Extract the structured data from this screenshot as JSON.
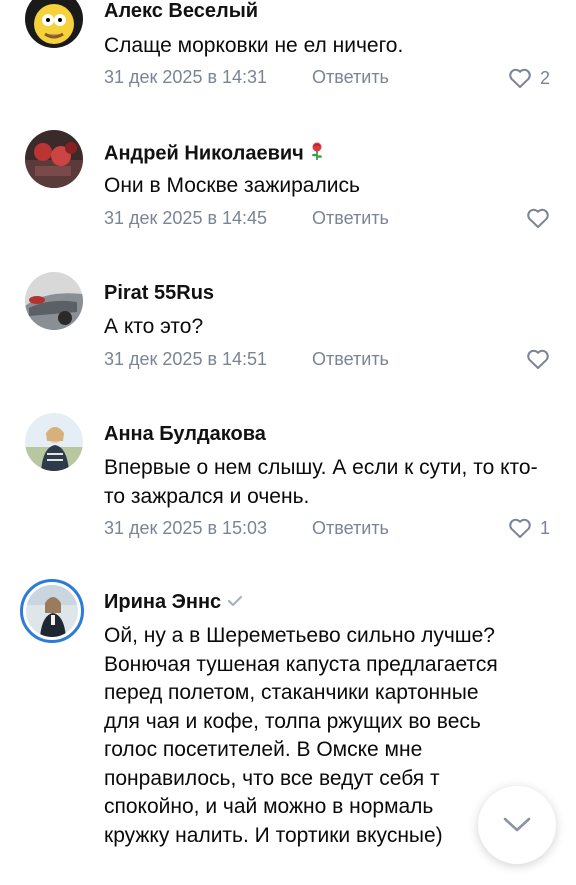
{
  "comments": [
    {
      "author": "Алекс Веселый",
      "text": "Слаще морковки не ел ничего.",
      "date": "31 дек 2025 в 14:31",
      "reply_label": "Ответить",
      "likes": "2",
      "avatar_icon": "cartoon-avatar"
    },
    {
      "author": "Андрей Николаевич",
      "text": "Они в Москве зажирались",
      "date": "31 дек 2025 в 14:45",
      "reply_label": "Ответить",
      "likes": "",
      "avatar_icon": "photo-avatar",
      "badge_icon": "rose-emoji-icon"
    },
    {
      "author": "Pirat 55Rus",
      "text": "А кто это?",
      "date": "31 дек 2025 в 14:51",
      "reply_label": "Ответить",
      "likes": "",
      "avatar_icon": "car-photo-avatar"
    },
    {
      "author": "Анна Булдакова",
      "text": "Впервые о нем слышу. А если к сути, то кто-то зажрался и очень.",
      "date": "31 дек 2025 в 15:03",
      "reply_label": "Ответить",
      "likes": "1",
      "avatar_icon": "photo-avatar"
    },
    {
      "author": "Ирина Эннс",
      "text": "Ой, ну а в Шереметьево сильно лучше? Вонючая тушеная капуста предлагается перед полетом, стаканчики картонные для чая и кофе, толпа ржущих во весь голос посетителей. В Омске мне понравилось, что все ведут себя т спокойно, и чай можно в нормаль кружку налить. И тортики вкусные)",
      "avatar_icon": "photo-avatar-with-story-ring",
      "badge_icon": "verified-check-icon"
    }
  ],
  "colors": {
    "meta": "#7b8494",
    "accent": "#2c7bd9",
    "text": "#0a0a0a"
  },
  "scroll_button_icon": "chevron-down-icon"
}
